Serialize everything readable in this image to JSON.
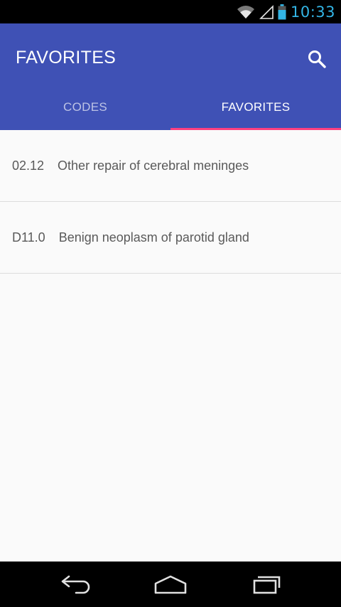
{
  "status_bar": {
    "time": "10:33",
    "icons": [
      "wifi-icon",
      "signal-icon",
      "battery-icon"
    ]
  },
  "app_bar": {
    "title": "FAVORITES",
    "background_color": "#3f51b5",
    "search_icon": "search-icon"
  },
  "tabs": [
    {
      "label": "CODES",
      "selected": false
    },
    {
      "label": "FAVORITES",
      "selected": true
    }
  ],
  "accent_color": "#ff4081",
  "favorites": [
    {
      "code": "02.12",
      "description": "Other repair of cerebral meninges"
    },
    {
      "code": "D11.0",
      "description": "Benign neoplasm of parotid gland"
    }
  ],
  "nav_bar": {
    "buttons": [
      "back-icon",
      "home-icon",
      "recent-apps-icon"
    ]
  }
}
